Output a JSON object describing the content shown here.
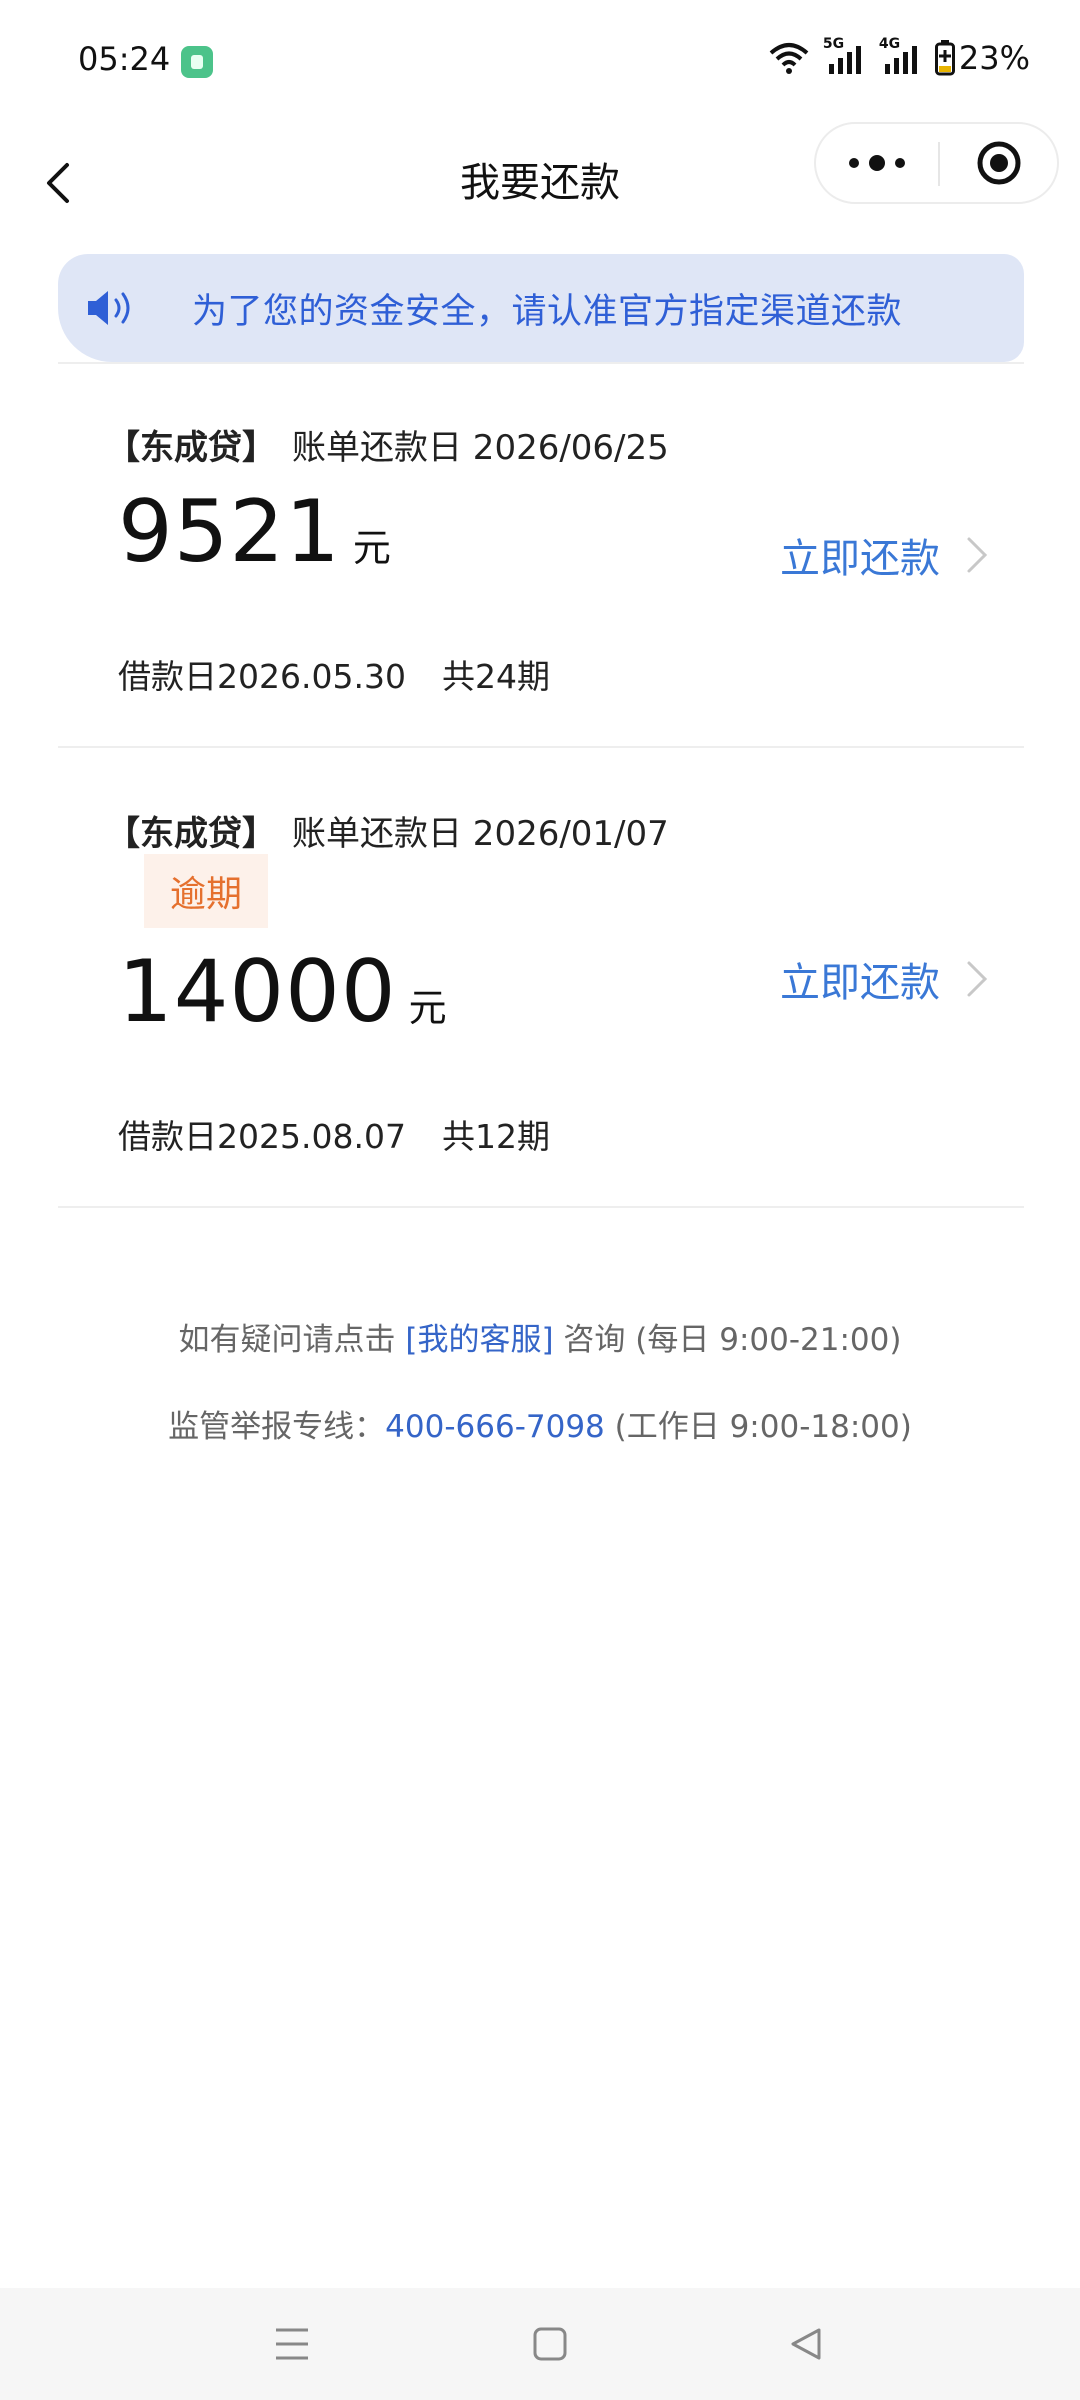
{
  "status_bar": {
    "time": "05:24",
    "battery": "23%",
    "network_1": "5G",
    "network_2": "4G",
    "icons": [
      "wifi-icon",
      "signal-icon",
      "battery-icon"
    ]
  },
  "nav": {
    "title": "我要还款"
  },
  "notice": {
    "text": "为了您的资金安全，请认准官方指定渠道还款"
  },
  "loans": [
    {
      "name": "【东成贷】",
      "due_label": "账单还款日 2026/06/25",
      "status": "",
      "amount": "9521",
      "unit": "元",
      "action": "立即还款",
      "loan_date": "借款日2026.05.30",
      "periods": "共24期"
    },
    {
      "name": "【东成贷】",
      "due_label": "账单还款日 2026/01/07",
      "status": "逾期",
      "amount": "14000",
      "unit": "元",
      "action": "立即还款",
      "loan_date": "借款日2025.08.07",
      "periods": "共12期"
    }
  ],
  "help": {
    "line1_prefix": "如有疑问请点击 ",
    "line1_link": "[我的客服]",
    "line1_suffix": " 咨询 (每日 9:00-21:00)",
    "line2_prefix": "监管举报专线：",
    "line2_phone": "400-666-7098",
    "line2_suffix": " (工作日 9:00-18:00)"
  },
  "colors": {
    "accent": "#3a78d6",
    "notice_bg": "#dfe6f6",
    "overdue": "#e5702e"
  }
}
